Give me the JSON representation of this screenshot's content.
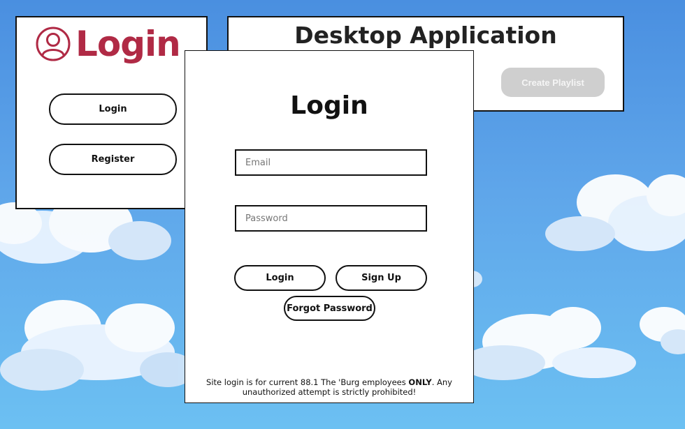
{
  "left_panel": {
    "brand_text": "Login",
    "login_label": "Login",
    "register_label": "Register"
  },
  "app_panel": {
    "title": "Desktop Application",
    "create_playlist_label": "Create Playlist"
  },
  "login_card": {
    "title": "Login",
    "email_placeholder": "Email",
    "password_placeholder": "Password",
    "login_label": "Login",
    "signup_label": "Sign Up",
    "forgot_label": "Forgot Password",
    "notice_prefix": "Site login is for current 88.1 The 'Burg employees ",
    "notice_emphasis": "ONLY",
    "notice_suffix": ". Any unauthorized attempt is strictly prohibited!"
  },
  "colors": {
    "brand": "#b02a45",
    "sky_top": "#4a8fe0",
    "sky_bottom": "#6cc0f2",
    "disabled_button": "#cfcfcf"
  },
  "icons": {
    "brand_icon": "user-circle-icon"
  }
}
